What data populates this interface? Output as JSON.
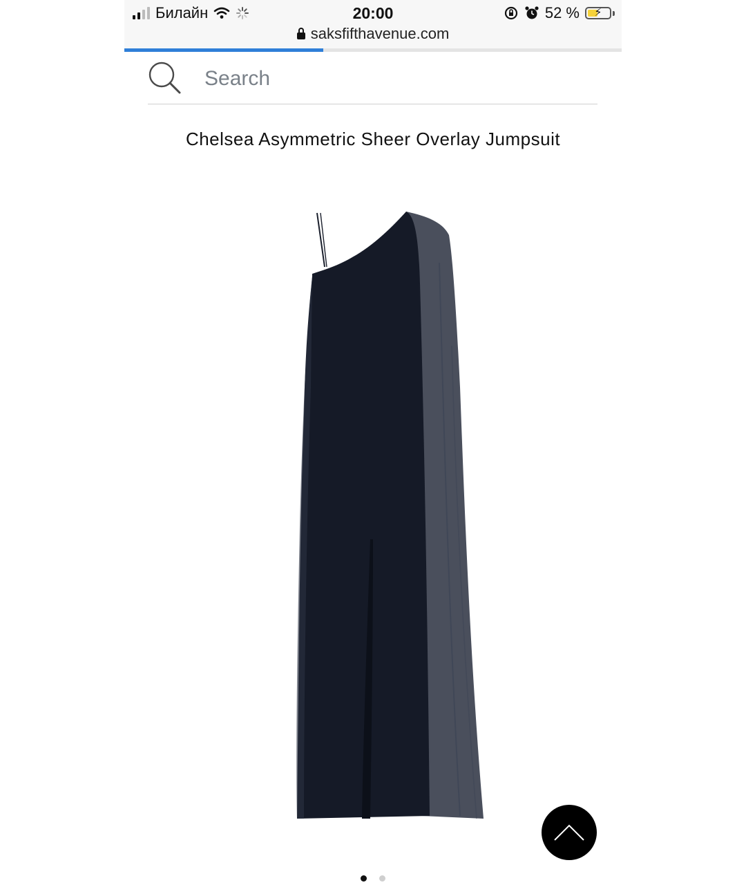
{
  "status_bar": {
    "carrier": "Билайн",
    "time": "20:00",
    "battery_percent": "52 %",
    "battery_level": 0.52
  },
  "browser": {
    "url": "saksfifthavenue.com",
    "load_progress": 0.4
  },
  "search": {
    "placeholder": "Search"
  },
  "product": {
    "title": "Chelsea Asymmetric Sheer Overlay Jumpsuit",
    "image_alt": "navy one-shoulder sheer overlay jumpsuit"
  },
  "carousel": {
    "total": 2,
    "active": 1
  },
  "colors": {
    "garment": "#151a27",
    "progress": "#2f7fd8",
    "button": "#000000"
  }
}
